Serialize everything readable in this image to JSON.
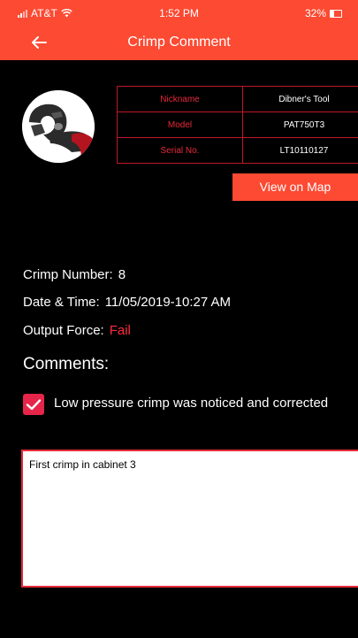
{
  "status_bar": {
    "carrier": "AT&T",
    "time": "1:52 PM",
    "battery": "32%"
  },
  "header": {
    "title": "Crimp Comment",
    "back_icon": "back-arrow-icon",
    "color": "#fc4a33"
  },
  "tool": {
    "image": "crimp-tool-image",
    "specs": [
      {
        "label": "Nickname",
        "value": "Dibner's Tool"
      },
      {
        "label": "Model",
        "value": "PAT750T3"
      },
      {
        "label": "Serial No.",
        "value": "LT10110127"
      }
    ],
    "map_button": "View on Map"
  },
  "crimp": {
    "number_label": "Crimp Number:",
    "number_value": "8",
    "datetime_label": "Date & Time:",
    "datetime_value": "11/05/2019-10:27 AM",
    "force_label": "Output Force:",
    "force_value": "Fail"
  },
  "comments": {
    "title": "Comments:",
    "checkbox_checked": true,
    "checkbox_label": "Low pressure crimp was noticed and corrected",
    "text": "First crimp in cabinet 3"
  },
  "colors": {
    "accent": "#fc4a33",
    "table_border": "#c0182a",
    "fail": "#ff2d3a",
    "checkbox": "#e7254a"
  }
}
